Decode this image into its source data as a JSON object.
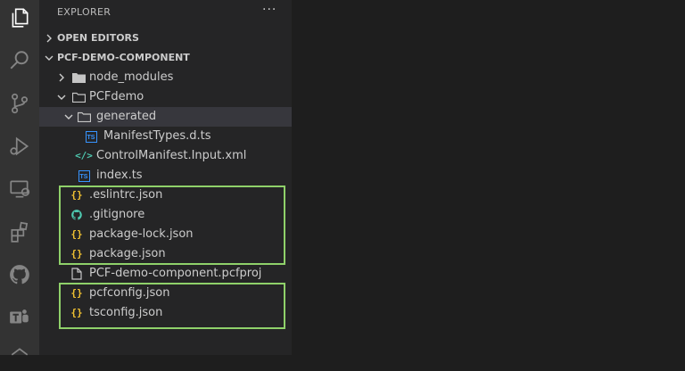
{
  "explorer": {
    "title": "EXPLORER",
    "more_actions": "···",
    "sections": {
      "open_editors": "OPEN EDITORS",
      "project": "PCF-DEMO-COMPONENT"
    }
  },
  "tree": {
    "node_modules": "node_modules",
    "pcfdemo": "PCFdemo",
    "generated": "generated",
    "manifest_types": "ManifestTypes.d.ts",
    "control_manifest": "ControlManifest.Input.xml",
    "index_ts": "index.ts",
    "eslintrc": ".eslintrc.json",
    "gitignore": ".gitignore",
    "package_lock": "package-lock.json",
    "package_json": "package.json",
    "pcfproj": "PCF-demo-component.pcfproj",
    "pcfconfig": "pcfconfig.json",
    "tsconfig": "tsconfig.json"
  },
  "icons": {
    "ts_badge": "TS",
    "braces": "{}",
    "xml": "</>"
  },
  "colors": {
    "highlight_box": "#8fd16a",
    "json_icon": "#f1c232",
    "ts_icon": "#3794ff",
    "xml_icon": "#4ec9b0",
    "selected_row": "#37373d"
  }
}
